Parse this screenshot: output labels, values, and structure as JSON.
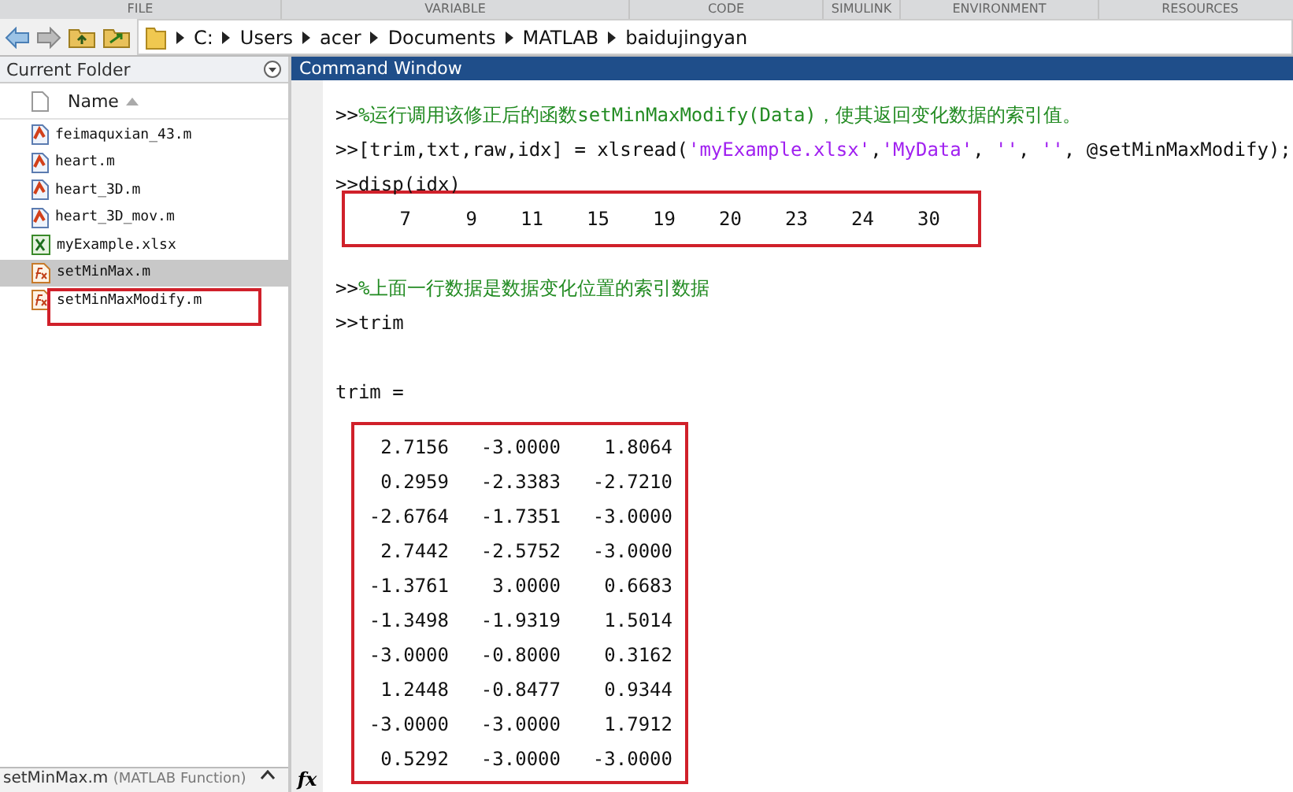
{
  "toolstrip": {
    "sections": [
      "FILE",
      "VARIABLE",
      "CODE",
      "SIMULINK",
      "ENVIRONMENT",
      "RESOURCES"
    ]
  },
  "address": {
    "folders": [
      "C:",
      "Users",
      "acer",
      "Documents",
      "MATLAB",
      "baidujingyan"
    ]
  },
  "current_folder": {
    "title": "Current Folder",
    "column": "Name",
    "files": [
      {
        "name": "feimaquxian_43.m",
        "kind": "script",
        "selected": false,
        "highlighted": false
      },
      {
        "name": "heart.m",
        "kind": "script",
        "selected": false,
        "highlighted": false
      },
      {
        "name": "heart_3D.m",
        "kind": "script",
        "selected": false,
        "highlighted": false
      },
      {
        "name": "heart_3D_mov.m",
        "kind": "script",
        "selected": false,
        "highlighted": false
      },
      {
        "name": "myExample.xlsx",
        "kind": "excel",
        "selected": false,
        "highlighted": false
      },
      {
        "name": "setMinMax.m",
        "kind": "function",
        "selected": true,
        "highlighted": false
      },
      {
        "name": "setMinMaxModify.m",
        "kind": "function",
        "selected": false,
        "highlighted": true
      }
    ],
    "details": {
      "name": "setMinMax.m",
      "type": "(MATLAB Function)"
    }
  },
  "command_window": {
    "title": "Command Window",
    "lines": [
      {
        "kind": "input",
        "prompt": ">>",
        "parts": [
          {
            "kind": "comment",
            "text": "%运行调用该修正后的函数setMinMaxModify(Data)，使其返回变化数据的索引值。"
          }
        ]
      },
      {
        "kind": "input",
        "prompt": ">>",
        "parts": [
          {
            "kind": "code",
            "text": "[trim,txt,raw,idx] = xlsread("
          },
          {
            "kind": "string",
            "text": "'myExample.xlsx'"
          },
          {
            "kind": "code",
            "text": ","
          },
          {
            "kind": "string",
            "text": "'MyData'"
          },
          {
            "kind": "code",
            "text": ", "
          },
          {
            "kind": "string",
            "text": "''"
          },
          {
            "kind": "code",
            "text": ", "
          },
          {
            "kind": "string",
            "text": "''"
          },
          {
            "kind": "code",
            "text": ", @setMinMaxModify);"
          }
        ]
      },
      {
        "kind": "input",
        "prompt": ">>",
        "parts": [
          {
            "kind": "code",
            "text": "disp(idx)"
          }
        ]
      },
      {
        "kind": "row",
        "highlighted": true,
        "values": [
          "7",
          "9",
          "11",
          "15",
          "19",
          "20",
          "23",
          "24",
          "30"
        ]
      },
      {
        "kind": "blank"
      },
      {
        "kind": "input",
        "prompt": ">>",
        "parts": [
          {
            "kind": "comment",
            "text": "%上面一行数据是数据变化位置的索引数据"
          }
        ]
      },
      {
        "kind": "input",
        "prompt": ">>",
        "parts": [
          {
            "kind": "code",
            "text": "trim"
          }
        ]
      },
      {
        "kind": "blank"
      },
      {
        "kind": "output",
        "text": "trim ="
      },
      {
        "kind": "matrix",
        "highlighted": true,
        "rows": [
          [
            "2.7156",
            "-3.0000",
            "1.8064"
          ],
          [
            "0.2959",
            "-2.3383",
            "-2.7210"
          ],
          [
            "-2.6764",
            "-1.7351",
            "-3.0000"
          ],
          [
            "2.7442",
            "-2.5752",
            "-3.0000"
          ],
          [
            "-1.3761",
            "3.0000",
            "0.6683"
          ],
          [
            "-1.3498",
            "-1.9319",
            "1.5014"
          ],
          [
            "-3.0000",
            "-0.8000",
            "0.3162"
          ],
          [
            "1.2448",
            "-0.8477",
            "0.9344"
          ],
          [
            "-3.0000",
            "-3.0000",
            "1.7912"
          ],
          [
            "0.5292",
            "-3.0000",
            "-3.0000"
          ]
        ]
      }
    ],
    "function_prompt": "fx"
  }
}
